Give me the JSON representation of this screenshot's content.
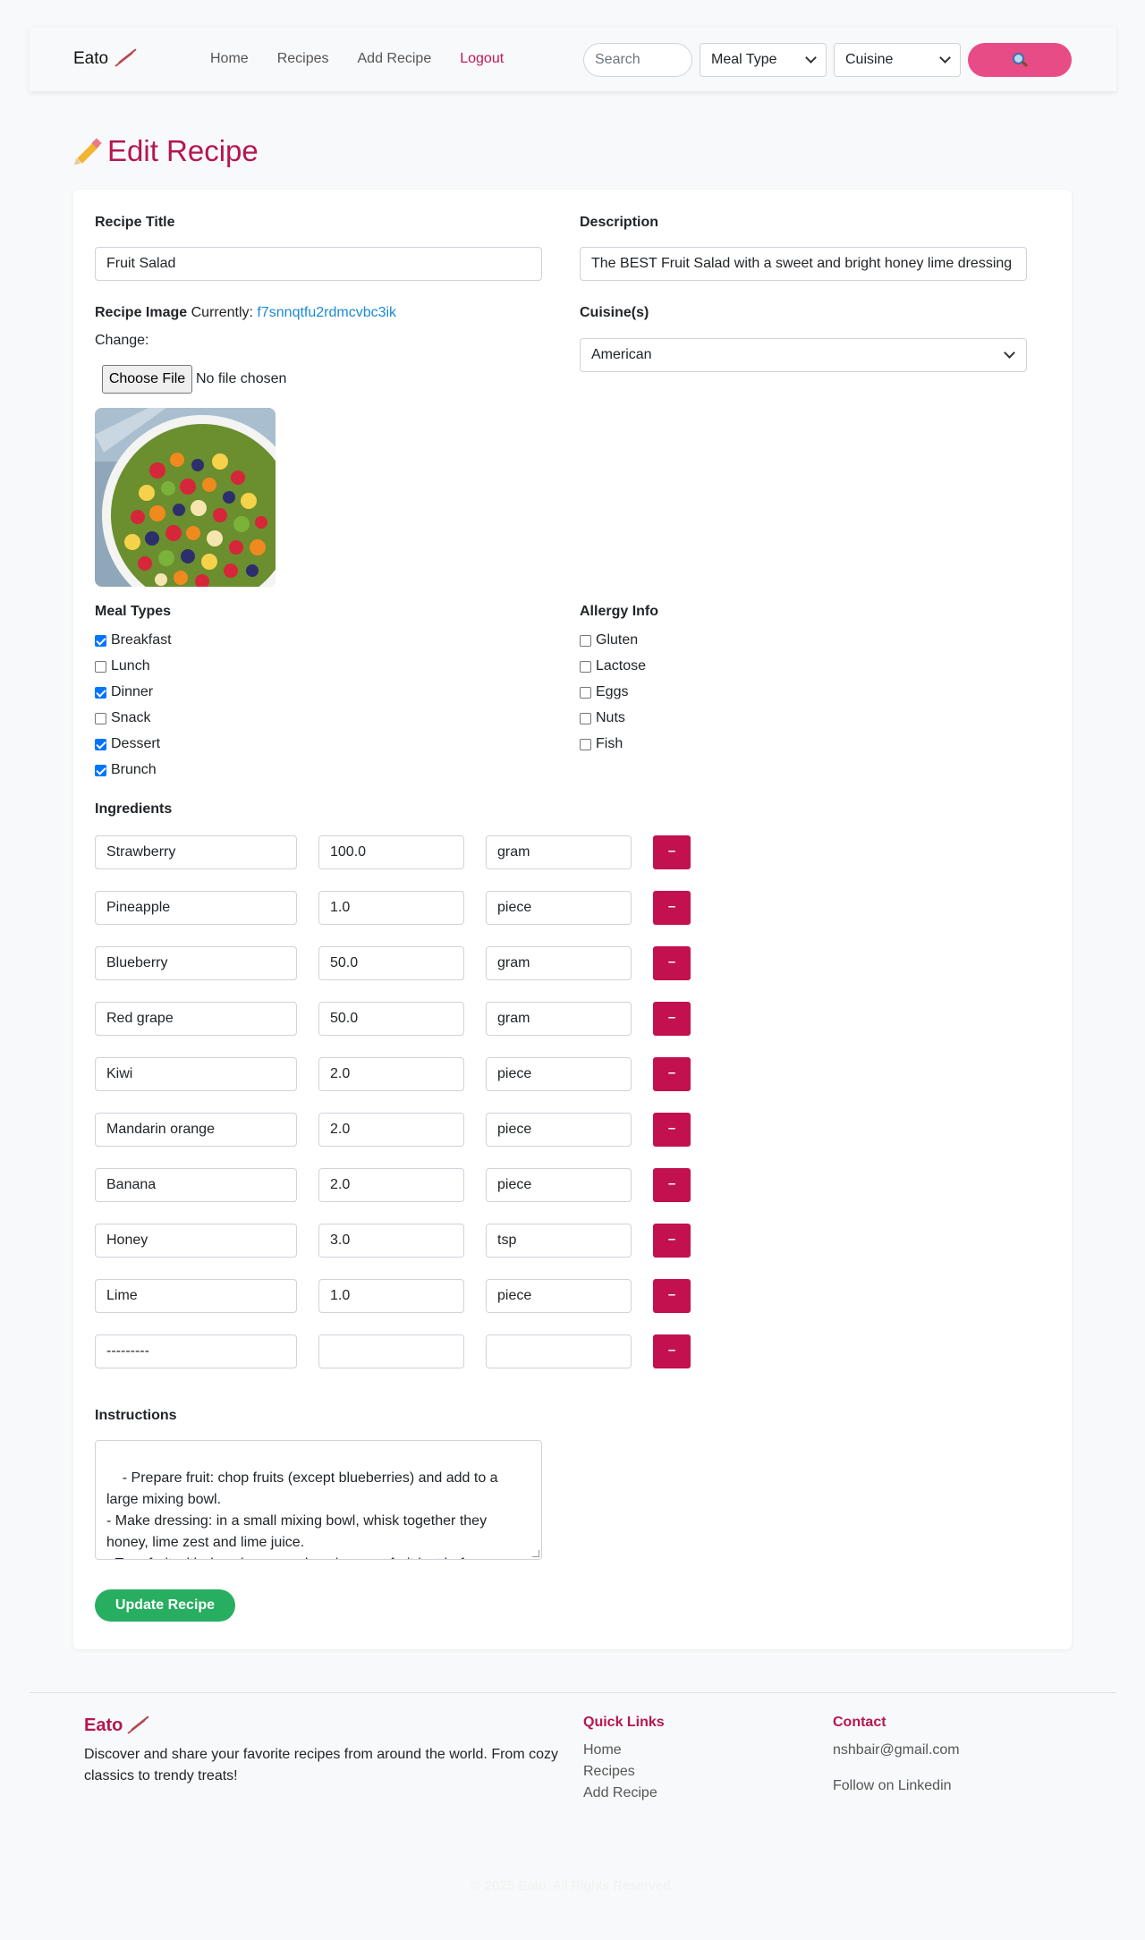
{
  "nav": {
    "brand": "Eato",
    "links": [
      "Home",
      "Recipes",
      "Add Recipe"
    ],
    "logout": "Logout",
    "search_placeholder": "Search",
    "meal_type": "Meal Type",
    "cuisine": "Cuisine",
    "search_button_icon": "magnifier-icon"
  },
  "page": {
    "title": "Edit Recipe",
    "title_icon": "pencil-icon"
  },
  "form": {
    "title_label": "Recipe Title",
    "title_value": "Fruit Salad",
    "description_label": "Description",
    "description_value": "The BEST Fruit Salad with a sweet and bright honey lime dressing",
    "image_label": "Recipe Image",
    "currently_text": "Currently:",
    "current_image_name": "f7snnqtfu2rdmcvbc3ik",
    "change_text": "Change:",
    "choose_file": "Choose File",
    "no_file": "No file chosen",
    "cuisine_label": "Cuisine(s)",
    "cuisine_value": "American",
    "meal_types_label": "Meal Types",
    "meal_types": [
      {
        "label": "Breakfast",
        "checked": true
      },
      {
        "label": "Lunch",
        "checked": false
      },
      {
        "label": "Dinner",
        "checked": true
      },
      {
        "label": "Snack",
        "checked": false
      },
      {
        "label": "Dessert",
        "checked": true
      },
      {
        "label": "Brunch",
        "checked": true
      }
    ],
    "allergy_label": "Allergy Info",
    "allergies": [
      {
        "label": "Gluten",
        "checked": false
      },
      {
        "label": "Lactose",
        "checked": false
      },
      {
        "label": "Eggs",
        "checked": false
      },
      {
        "label": "Nuts",
        "checked": false
      },
      {
        "label": "Fish",
        "checked": false
      }
    ],
    "ingredients_label": "Ingredients",
    "remove_label": "–",
    "ingredients": [
      {
        "name": "Strawberry",
        "qty": "100.0",
        "unit": "gram"
      },
      {
        "name": "Pineapple",
        "qty": "1.0",
        "unit": "piece"
      },
      {
        "name": "Blueberry",
        "qty": "50.0",
        "unit": "gram"
      },
      {
        "name": "Red grape",
        "qty": "50.0",
        "unit": "gram"
      },
      {
        "name": "Kiwi",
        "qty": "2.0",
        "unit": "piece"
      },
      {
        "name": "Mandarin orange",
        "qty": "2.0",
        "unit": "piece"
      },
      {
        "name": "Banana",
        "qty": "2.0",
        "unit": "piece"
      },
      {
        "name": "Honey",
        "qty": "3.0",
        "unit": "tsp"
      },
      {
        "name": "Lime",
        "qty": "1.0",
        "unit": "piece"
      },
      {
        "name": "---------",
        "qty": "",
        "unit": ""
      }
    ],
    "instructions_label": "Instructions",
    "instructions_value": "- Prepare fruit: chop fruits (except blueberries) and add to a large mixing bowl.\n- Make dressing: in a small mixing bowl, whisk together they honey, lime zest and lime juice.\n- Toss fruit with dressing: pour dressing over fruit just before serving and toss gently.",
    "update_button": "Update Recipe"
  },
  "footer": {
    "brand": "Eato",
    "description": "Discover and share your favorite recipes from around the world. From cozy classics to trendy treats!",
    "quick_links_heading": "Quick Links",
    "quick_links": [
      "Home",
      "Recipes",
      "Add Recipe"
    ],
    "contact_heading": "Contact",
    "email": "nshbair@gmail.com",
    "linkedin": "Follow on Linkedin",
    "copyright": "© 2025 Eato. All Rights Reserved."
  },
  "colors": {
    "accent": "#b5174f",
    "search_button": "#e84c86",
    "remove_button": "#c2114e",
    "update_button": "#27ae60",
    "link": "#1a8ad4"
  }
}
